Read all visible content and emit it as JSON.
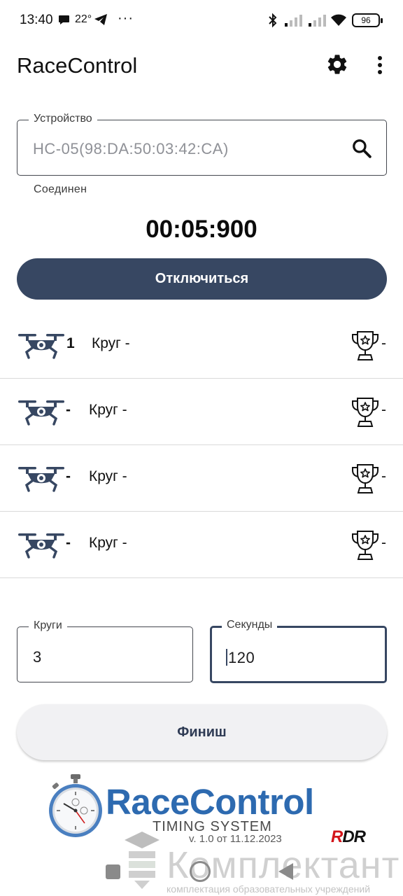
{
  "status_bar": {
    "time": "13:40",
    "temperature": "22°",
    "dots": "···",
    "battery": "96"
  },
  "app_bar": {
    "title": "RaceControl",
    "settings_icon": "gear-icon",
    "menu_icon": "more-vert-icon"
  },
  "device_field": {
    "label": "Устройство",
    "value": "HC-05(98:DA:50:03:42:CA)",
    "icon": "search-icon"
  },
  "connection_status": "Соединен",
  "timer": "00:05:900",
  "disconnect_button": "Отключиться",
  "racers": [
    {
      "number": "1",
      "lap": "Круг -",
      "best": "-"
    },
    {
      "number": "-",
      "lap": "Круг -",
      "best": "-"
    },
    {
      "number": "-",
      "lap": "Круг -",
      "best": "-"
    },
    {
      "number": "-",
      "lap": "Круг -",
      "best": "-"
    }
  ],
  "laps_field": {
    "label": "Круги",
    "value": "3"
  },
  "seconds_field": {
    "label": "Секунды",
    "value": "120"
  },
  "finish_button": "Финиш",
  "logo": {
    "name": "RaceControl",
    "subtitle": "TIMING SYSTEM",
    "version": "v. 1.0 от 11.12.2023",
    "rdr_r": "R",
    "rdr_dr": "DR"
  },
  "watermark": {
    "name": "Комплектант",
    "subtitle": "комплектация образовательных учреждений"
  },
  "colors": {
    "primary": "#374762",
    "logo_blue": "#2d6ab0",
    "rdr_red": "#d3161b"
  }
}
